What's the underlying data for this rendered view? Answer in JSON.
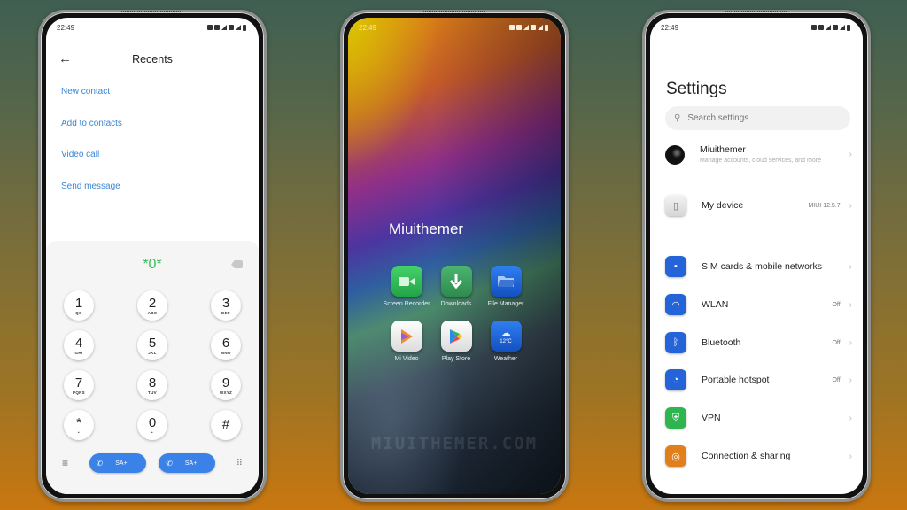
{
  "status_bar": {
    "time": "22:49"
  },
  "dialer": {
    "title": "Recents",
    "actions": [
      "New contact",
      "Add to contacts",
      "Video call",
      "Send message"
    ],
    "dialed_number": "*0*",
    "keys": [
      {
        "digit": "1",
        "letters": "QO"
      },
      {
        "digit": "2",
        "letters": "ABC"
      },
      {
        "digit": "3",
        "letters": "DEF"
      },
      {
        "digit": "4",
        "letters": "GHI"
      },
      {
        "digit": "5",
        "letters": "JKL"
      },
      {
        "digit": "6",
        "letters": "MNO"
      },
      {
        "digit": "7",
        "letters": "PQRS"
      },
      {
        "digit": "8",
        "letters": "TUV"
      },
      {
        "digit": "9",
        "letters": "WXYZ"
      },
      {
        "digit": "*",
        "letters": "•"
      },
      {
        "digit": "0",
        "letters": "•"
      },
      {
        "digit": "#",
        "letters": ""
      }
    ],
    "call_buttons": [
      {
        "sim": "1",
        "label": "SA+"
      },
      {
        "sim": "2",
        "label": "SA+"
      }
    ]
  },
  "home": {
    "folder_title": "Miuithemer",
    "apps": [
      {
        "label": "Screen Recorder",
        "icon": "video-camera-icon",
        "color": "#2fb24f"
      },
      {
        "label": "Downloads",
        "icon": "download-arrow-icon",
        "color": "#3a9a5a"
      },
      {
        "label": "File Manager",
        "icon": "folder-icon",
        "color": "#1c63d6"
      },
      {
        "label": "Mi Video",
        "icon": "play-icon",
        "color": "#f2f2f2"
      },
      {
        "label": "Play Store",
        "icon": "play-store-icon",
        "color": "#f2f2f2"
      },
      {
        "label": "Weather",
        "icon": "weather-cloud-icon",
        "color": "#1c63d6",
        "temp": "12°C"
      }
    ],
    "watermark": "MIUITHEMER.COM"
  },
  "settings": {
    "title": "Settings",
    "search_placeholder": "Search settings",
    "account": {
      "name": "Miuithemer",
      "subtitle": "Manage accounts, cloud services, and more"
    },
    "device": {
      "name": "My device",
      "value": "MIUI 12.5.7"
    },
    "items": [
      {
        "name": "SIM cards & mobile networks",
        "value": "",
        "icon": "sim-card-icon",
        "color": "#2563d9"
      },
      {
        "name": "WLAN",
        "value": "Off",
        "icon": "wifi-icon",
        "color": "#2563d9"
      },
      {
        "name": "Bluetooth",
        "value": "Off",
        "icon": "bluetooth-icon",
        "color": "#2563d9"
      },
      {
        "name": "Portable hotspot",
        "value": "Off",
        "icon": "hotspot-icon",
        "color": "#2563d9"
      },
      {
        "name": "VPN",
        "value": "",
        "icon": "vpn-shield-icon",
        "color": "#2fb54f"
      },
      {
        "name": "Connection & sharing",
        "value": "",
        "icon": "connection-sharing-icon",
        "color": "#e07f1c"
      }
    ]
  }
}
